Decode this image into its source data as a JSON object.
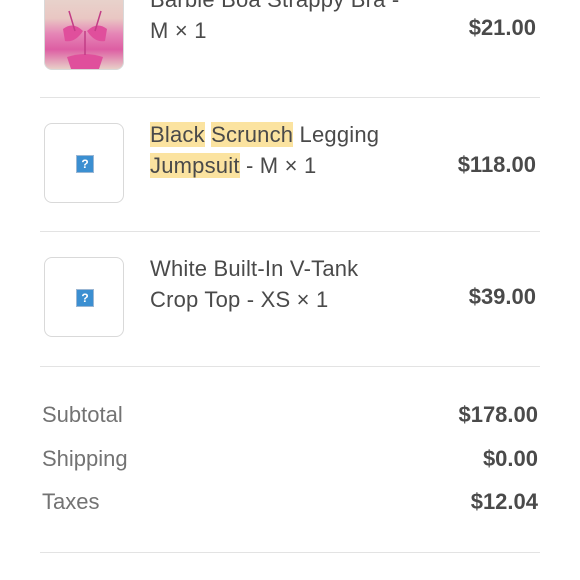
{
  "items": [
    {
      "name_line1": "Barbie Boa Strappy Bra -",
      "name_line2": "M × 1",
      "price": "$21.00",
      "image": "product-photo-pink-bra"
    },
    {
      "name_word1": "Black",
      "name_word2": "Scrunch",
      "name_word3": "Legging",
      "name_word4": "Jumpsuit",
      "name_rest": " - M × 1",
      "price": "$118.00",
      "image": "missing-image-icon"
    },
    {
      "name_line1": "White Built-In V-Tank",
      "name_line2": "Crop Top - XS × 1",
      "price": "$39.00",
      "image": "missing-image-icon"
    }
  ],
  "placeholder_glyph": "?",
  "totals": {
    "subtotal_label": "Subtotal",
    "subtotal_value": "$178.00",
    "shipping_label": "Shipping",
    "shipping_value": "$0.00",
    "taxes_label": "Taxes",
    "taxes_value": "$12.04"
  },
  "colors": {
    "highlight": "#fbe3a0",
    "text": "#4a4a4a",
    "muted": "#737373",
    "divider": "#e3e3e3"
  }
}
